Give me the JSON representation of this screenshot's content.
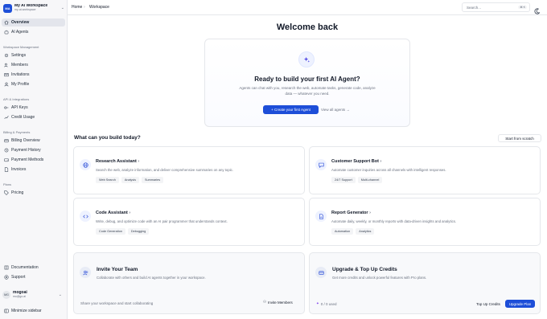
{
  "workspace": {
    "initials": "MA",
    "name": "My AI Workspace",
    "subtitle": "my-ai-workspace"
  },
  "sidebar": {
    "top_items": [
      {
        "label": "Overview",
        "icon": "home-icon",
        "active": true
      },
      {
        "label": "AI Agents",
        "icon": "bot-icon"
      }
    ],
    "sections": [
      {
        "title": "Workspace Management",
        "items": [
          {
            "label": "Settings",
            "icon": "gear-icon"
          },
          {
            "label": "Members",
            "icon": "users-icon"
          },
          {
            "label": "Invitations",
            "icon": "mail-icon"
          },
          {
            "label": "My Profile",
            "icon": "user-icon"
          }
        ]
      },
      {
        "title": "API & Integrations",
        "items": [
          {
            "label": "API Keys",
            "icon": "key-icon"
          },
          {
            "label": "Credit Usage",
            "icon": "chart-icon"
          }
        ]
      },
      {
        "title": "Billing & Payments",
        "items": [
          {
            "label": "Billing Overview",
            "icon": "card-icon"
          },
          {
            "label": "Payment History",
            "icon": "receipt-icon"
          },
          {
            "label": "Payment Methods",
            "icon": "wallet-icon"
          },
          {
            "label": "Invoices",
            "icon": "document-icon"
          }
        ]
      },
      {
        "title": "Plans",
        "items": [
          {
            "label": "Pricing",
            "icon": "tag-icon"
          }
        ]
      }
    ],
    "footer_items": [
      {
        "label": "Documentation",
        "icon": "book-icon"
      },
      {
        "label": "Support",
        "icon": "help-icon"
      }
    ],
    "user": {
      "initials": "MG",
      "name": "mogoai",
      "email": "mo@go.ai"
    },
    "minimize_label": "Minimize sidebar"
  },
  "topbar": {
    "breadcrumb": [
      "Home",
      "Workspace"
    ],
    "search_placeholder": "Search...",
    "search_shortcut": "⌘ K"
  },
  "main": {
    "title": "Welcome back",
    "hero": {
      "title": "Ready to build your first AI Agent?",
      "description": "Agents can chat with you, research the web, automate tasks, generate code, analyze data — whatever you need.",
      "primary_button": "+ Create your first Agent",
      "secondary_link": "View all agents →"
    },
    "build_title": "What can you build today?",
    "start_scratch": "Start from scratch",
    "templates": [
      {
        "title": "Research Assistant",
        "description": "Search the web, analyze information, and deliver comprehensive summaries on any topic.",
        "tags": [
          "Web Search",
          "Analysis",
          "Summaries"
        ],
        "icon": "globe-icon"
      },
      {
        "title": "Customer Support Bot",
        "description": "Automate customer inquiries across all channels with intelligent responses.",
        "tags": [
          "24/7 Support",
          "Multi-channel"
        ],
        "icon": "chat-icon"
      },
      {
        "title": "Code Assistant",
        "description": "Write, debug, and optimize code with an AI pair programmer that understands context.",
        "tags": [
          "Code Generation",
          "Debugging"
        ],
        "icon": "code-icon"
      },
      {
        "title": "Report Generator",
        "description": "Automate daily, weekly, or monthly reports with data-driven insights and analytics.",
        "tags": [
          "Automation",
          "Analytics"
        ],
        "icon": "file-chart-icon"
      }
    ],
    "invite": {
      "title": "Invite Your Team",
      "description": "Collaborate with others and build AI agents together in your workspace.",
      "footer": "Share your workspace and start collaborating",
      "action": "Invite Members"
    },
    "upgrade": {
      "title": "Upgrade & Top Up Credits",
      "description": "Get more credits and unlock powerful features with Pro plans.",
      "usage": "0 / 0 used",
      "topup": "Top Up Credits",
      "upgrade": "Upgrade Plan"
    }
  }
}
